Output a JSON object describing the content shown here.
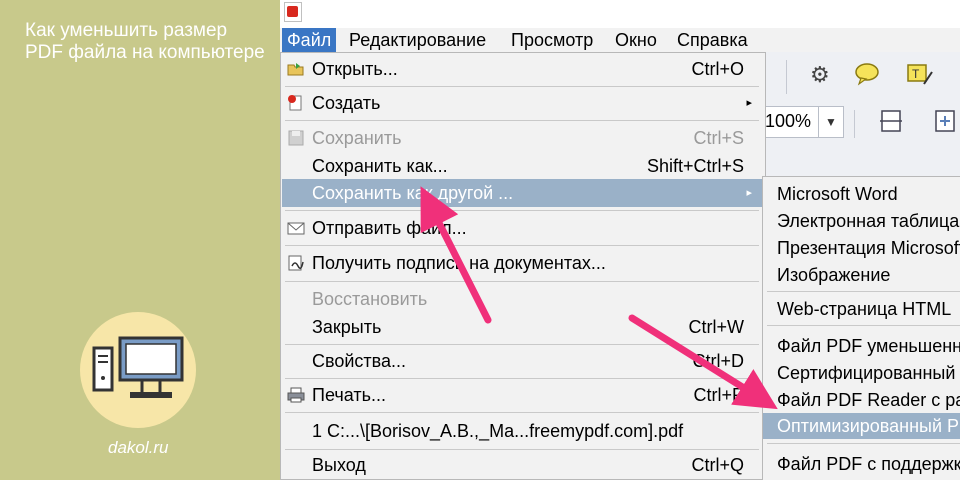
{
  "article": {
    "title": "Как уменьшить размер PDF файла на компьютере",
    "site": "dakol.ru"
  },
  "colors": {
    "panel": "#c8c98b",
    "menu_highlight": "#9ab1c8",
    "menubar_active": "#3a76c4",
    "pointer_arrow": "#f0307a"
  },
  "menubar": {
    "items": [
      "Файл",
      "Редактирование",
      "Просмотр",
      "Окно",
      "Справка"
    ],
    "active": "Файл"
  },
  "toolbar": {
    "zoom_value": "100%",
    "icons": [
      "gear-icon",
      "comment-icon",
      "text-edit-icon",
      "fit-width-icon",
      "fit-page-icon"
    ]
  },
  "file_menu": {
    "items": [
      {
        "icon": "open-folder-icon",
        "label": "Открыть...",
        "shortcut": "Ctrl+O"
      },
      {
        "icon": "create-icon",
        "label": "Создать",
        "submenu": "▸"
      },
      {
        "icon": "save-icon",
        "label": "Сохранить",
        "shortcut": "Ctrl+S",
        "disabled": true
      },
      {
        "label": "Сохранить как...",
        "shortcut": "Shift+Ctrl+S"
      },
      {
        "label": "Сохранить как другой ...",
        "submenu": "▸",
        "highlighted": true
      },
      {
        "icon": "mail-icon",
        "label": "Отправить файл..."
      },
      {
        "icon": "signature-icon",
        "label": "Получить подпись на документах..."
      },
      {
        "label": "Восстановить",
        "disabled": true
      },
      {
        "label": "Закрыть",
        "shortcut": "Ctrl+W"
      },
      {
        "label": "Свойства...",
        "shortcut": "Ctrl+D"
      },
      {
        "icon": "printer-icon",
        "label": "Печать...",
        "shortcut": "Ctrl+P"
      },
      {
        "label": "1 C:...\\[Borisov_A.B.,_Ma...freemypdf.com].pdf"
      },
      {
        "label": "Выход",
        "shortcut": "Ctrl+Q"
      }
    ]
  },
  "save_as_submenu": {
    "items": [
      "Microsoft Word",
      "Электронная таблица",
      "Презентация Microsoft",
      "Изображение",
      "Web-страница HTML",
      "Файл PDF уменьшенного размера",
      "Сертифицированный PDF",
      "Файл PDF Reader с расширенными функциями",
      "Оптимизированный PDF",
      "Файл PDF с поддержкой"
    ],
    "highlighted": "Оптимизированный PDF"
  }
}
